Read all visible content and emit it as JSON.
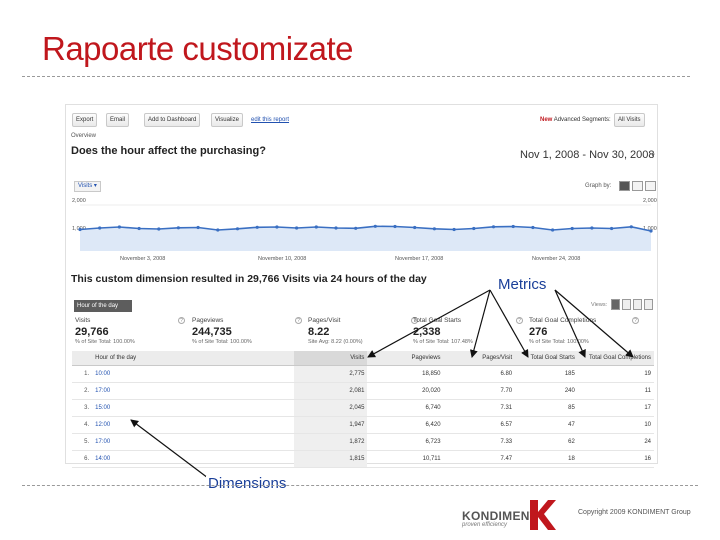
{
  "slide": {
    "title": "Rapoarte customizate",
    "copyright": "Copyright 2009 KONDIMENT Group"
  },
  "logo": {
    "name": "KONDIMENT",
    "tagline": "proven efficiency",
    "mark_color": "#c0171d"
  },
  "annotations": {
    "metrics": "Metrics",
    "dimensions": "Dimensions"
  },
  "report": {
    "toolbar": {
      "export": "Export",
      "email": "Email",
      "add_dashboard": "Add to Dashboard",
      "visualize": "Visualize",
      "edit_report": "edit this report",
      "advanced_segments_label": "Advanced Segments:",
      "segment_value": "All Visits"
    },
    "overview_label": "Overview",
    "question": "Does the hour affect the purchasing?",
    "date_range": "Nov 1, 2008 - Nov 30, 2008",
    "graph_metric": "Visits",
    "graph_by_label": "Graph by:",
    "y_axis_top": "2,000",
    "y_axis_mid": "1,000",
    "x_labels": [
      "November 3, 2008",
      "November 10, 2008",
      "November 17, 2008",
      "November 24, 2008"
    ],
    "summary_text": "This custom dimension resulted in 29,766 Visits via 24 hours of the day",
    "dimension_header": "Hour of the day",
    "views_label": "Views:",
    "metrics": [
      {
        "label": "Visits",
        "value": "29,766",
        "sub": "% of Site Total: 100.00%"
      },
      {
        "label": "Pageviews",
        "value": "244,735",
        "sub": "% of Site Total: 100.00%"
      },
      {
        "label": "Pages/Visit",
        "value": "8.22",
        "sub": "Site Avg: 8.22 (0.00%)"
      },
      {
        "label": "Total Goal Starts",
        "value": "2,338",
        "sub": "% of Site Total: 107.48%"
      },
      {
        "label": "Total Goal Completions",
        "value": "276",
        "sub": "% of Site Total: 100.00%"
      }
    ],
    "table": {
      "columns": [
        "Hour of the day",
        "Visits",
        "Pageviews",
        "Pages/Visit",
        "Total Goal Starts",
        "Total Goal Completions"
      ],
      "rows": [
        [
          "1.",
          "10:00",
          "2,775",
          "18,850",
          "6.80",
          "185",
          "19"
        ],
        [
          "2.",
          "17:00",
          "2,081",
          "20,020",
          "7.70",
          "240",
          "11"
        ],
        [
          "3.",
          "15:00",
          "2,045",
          "6,740",
          "7.31",
          "85",
          "17"
        ],
        [
          "4.",
          "12:00",
          "1,947",
          "6,420",
          "6.57",
          "47",
          "10"
        ],
        [
          "5.",
          "17:00",
          "1,872",
          "6,723",
          "7.33",
          "62",
          "24"
        ],
        [
          "6.",
          "14:00",
          "1,815",
          "10,711",
          "7.47",
          "18",
          "16"
        ]
      ]
    },
    "chart_data": {
      "type": "line",
      "series": [
        {
          "values": [
            1020,
            1080,
            1120,
            1060,
            1040,
            1090,
            1100,
            1000,
            1050,
            1110,
            1120,
            1080,
            1120,
            1080,
            1070,
            1150,
            1140,
            1100,
            1050,
            1020,
            1060,
            1130,
            1140,
            1100,
            1000,
            1060,
            1080,
            1060,
            1130,
            960
          ]
        }
      ],
      "ylim": [
        0,
        2000
      ],
      "colors": {
        "line": "#3a6fc2",
        "fill": "#dde8f7"
      }
    }
  }
}
